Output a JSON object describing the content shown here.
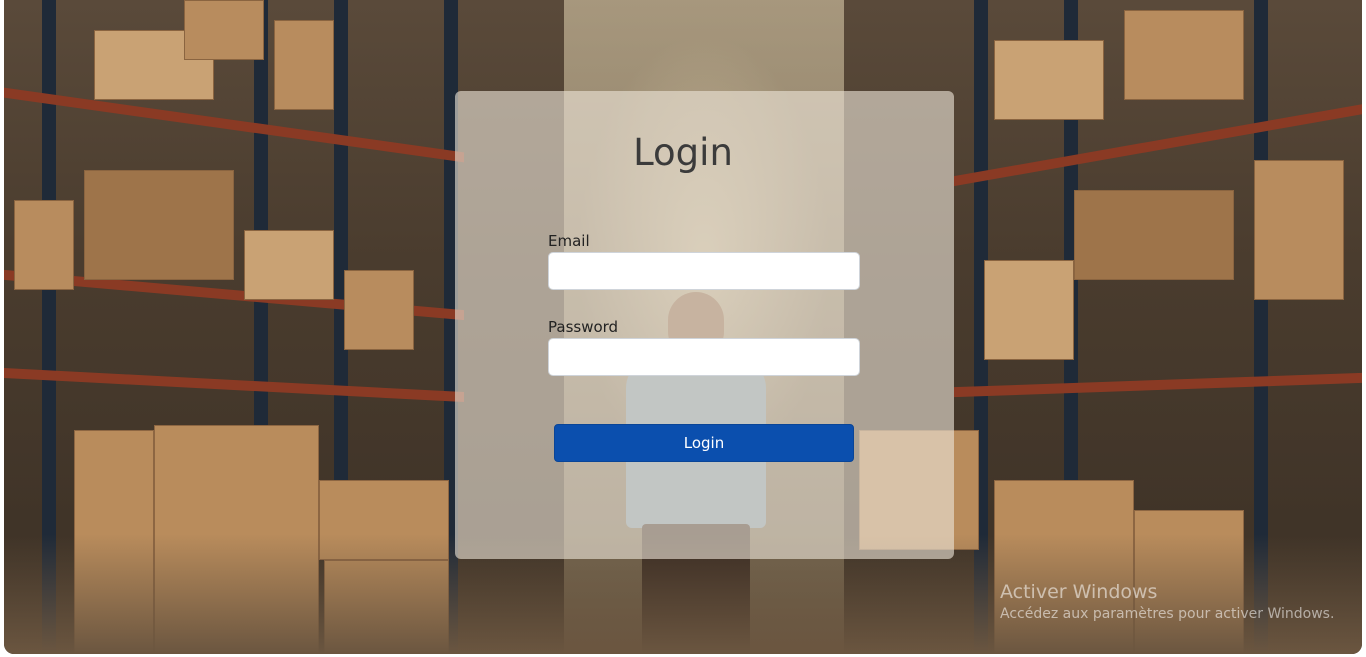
{
  "background": {
    "scene": "warehouse-aisle",
    "colors": {
      "shelf_post": "#1f2a38",
      "beam": "#8a3a24",
      "box": "#b88c5e",
      "glow": "#e6d7b4"
    }
  },
  "login_card": {
    "title": "Login",
    "email": {
      "label": "Email",
      "value": "",
      "placeholder": ""
    },
    "password": {
      "label": "Password",
      "value": "",
      "placeholder": ""
    },
    "submit_label": "Login",
    "accent": "#0b4fae"
  },
  "windows_watermark": {
    "title": "Activer Windows",
    "subtitle": "Accédez aux paramètres pour activer Windows."
  }
}
